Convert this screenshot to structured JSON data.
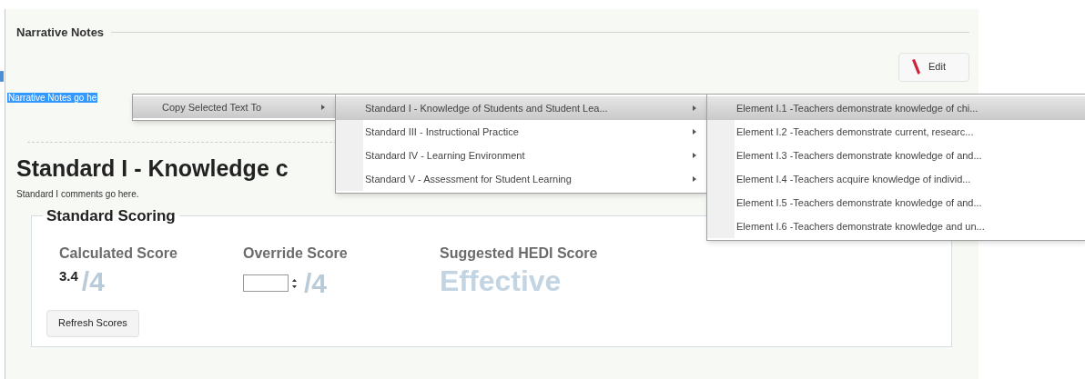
{
  "section": {
    "title": "Narrative Notes"
  },
  "edit_button": {
    "label": "Edit"
  },
  "notes": {
    "selected_text": "Narrative Notes go he"
  },
  "standard": {
    "title": "Standard I - Knowledge c",
    "comment": "Standard I comments go here."
  },
  "scoring": {
    "title": "Standard Scoring",
    "calculated": {
      "label": "Calculated Score",
      "value": "3.4",
      "max": "/4"
    },
    "override": {
      "label": "Override Score",
      "max": "/4"
    },
    "hedi": {
      "label": "Suggested HEDI Score",
      "value": "Effective"
    },
    "refresh_button": {
      "label": "Refresh Scores"
    }
  },
  "context_menu": {
    "items": [
      {
        "label": "Copy Selected Text To",
        "selected": true
      }
    ]
  },
  "submenu": {
    "items": [
      {
        "label": "Standard I - Knowledge of Students and Student Lea...",
        "selected": true
      },
      {
        "label": "Standard III - Instructional Practice",
        "selected": false
      },
      {
        "label": "Standard IV - Learning Environment",
        "selected": false
      },
      {
        "label": "Standard V - Assessment for Student Learning",
        "selected": false
      }
    ]
  },
  "element_menu": {
    "items": [
      {
        "label": "Element I.1 -Teachers demonstrate knowledge of chi...",
        "selected": true
      },
      {
        "label": "Element I.2 -Teachers demonstrate current, researc...",
        "selected": false
      },
      {
        "label": "Element I.3 -Teachers demonstrate knowledge of and...",
        "selected": false
      },
      {
        "label": "Element I.4 -Teachers acquire knowledge of individ...",
        "selected": false
      },
      {
        "label": "Element I.5 -Teachers demonstrate knowledge of and...",
        "selected": false
      },
      {
        "label": "Element I.6 -Teachers demonstrate knowledge and un...",
        "selected": false
      }
    ]
  }
}
